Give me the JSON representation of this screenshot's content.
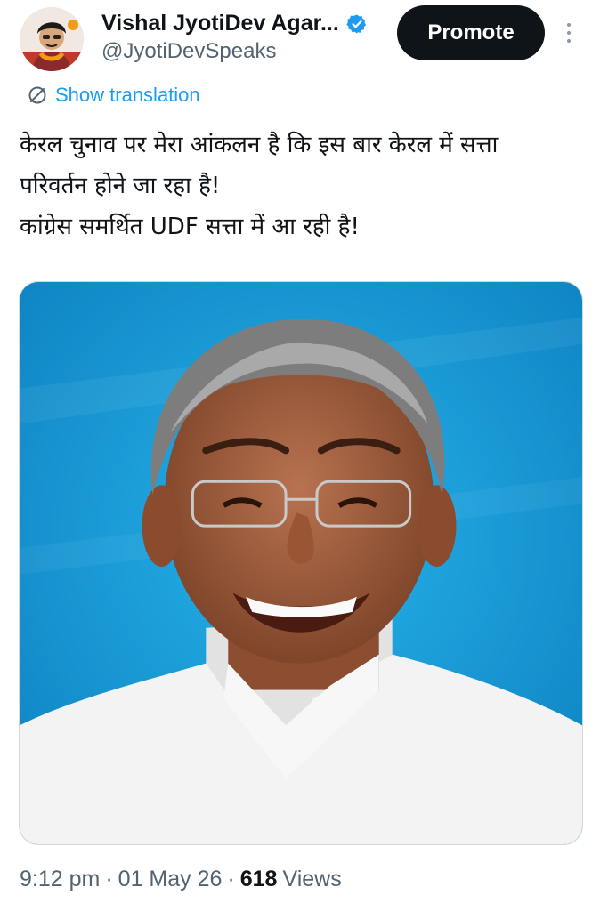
{
  "author": {
    "display_name": "Vishal JyotiDev Agar...",
    "handle": "@JyotiDevSpeaks",
    "verified": true,
    "avatar_icon": "avatar-cartoon-person-icon"
  },
  "actions": {
    "promote_label": "Promote",
    "more_icon": "more-vertical-icon"
  },
  "translation": {
    "label": "Show translation",
    "icon": "translate-icon"
  },
  "tweet": {
    "lines": [
      "केरल चुनाव पर मेरा आंकलन है कि इस बार केरल में सत्ता",
      "परिवर्तन होने जा रहा है!",
      "कांग्रेस समर्थित UDF सत्ता में आ रही है!"
    ]
  },
  "media": {
    "type": "photo",
    "background_color": "#1f9fd8"
  },
  "meta": {
    "time": "9:12 pm",
    "separator": "·",
    "date": "01 May 26",
    "views_count": "618",
    "views_label": "Views"
  },
  "colors": {
    "text_primary": "#0f1419",
    "text_secondary": "#536471",
    "accent": "#1d9bf0",
    "button_dark": "#0f1419"
  }
}
